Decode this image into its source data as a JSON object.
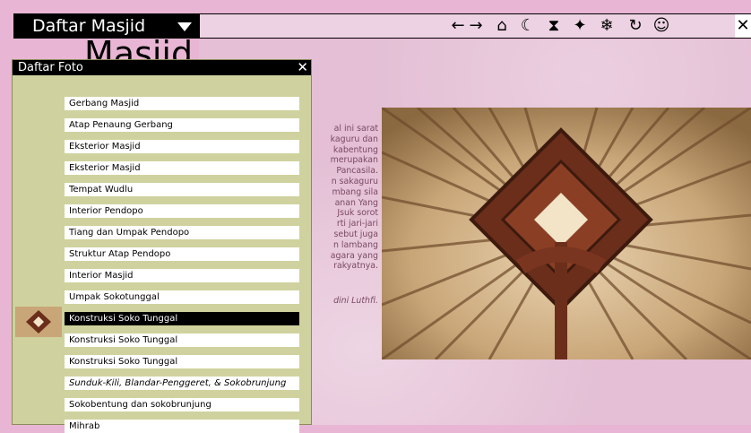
{
  "app": {
    "title": "Daftar Masjid",
    "background_heading": "Masjid"
  },
  "toolbar": {
    "icons": [
      {
        "name": "back-icon",
        "glyph": "←"
      },
      {
        "name": "forward-icon",
        "glyph": "→"
      },
      {
        "name": "home-icon",
        "glyph": "⌂"
      },
      {
        "name": "moon-icon",
        "glyph": "☾"
      },
      {
        "name": "hourglass-icon",
        "glyph": "⧗"
      },
      {
        "name": "compass-icon",
        "glyph": "✦"
      },
      {
        "name": "snowflake-icon",
        "glyph": "❄"
      },
      {
        "name": "refresh-icon",
        "glyph": "↻"
      },
      {
        "name": "smiley-icon",
        "glyph": "☺"
      }
    ],
    "close_glyph": "✕"
  },
  "panel": {
    "title": "Daftar Foto",
    "close_glyph": "✕",
    "items": [
      {
        "label": "Gerbang Masjid",
        "selected": false,
        "italic": false
      },
      {
        "label": "Atap Penaung Gerbang",
        "selected": false,
        "italic": false
      },
      {
        "label": "Eksterior Masjid",
        "selected": false,
        "italic": false
      },
      {
        "label": "Eksterior Masjid",
        "selected": false,
        "italic": false
      },
      {
        "label": "Tempat Wudlu",
        "selected": false,
        "italic": false
      },
      {
        "label": "Interior Pendopo",
        "selected": false,
        "italic": false
      },
      {
        "label": "Tiang dan Umpak Pendopo",
        "selected": false,
        "italic": false
      },
      {
        "label": "Struktur Atap Pendopo",
        "selected": false,
        "italic": false
      },
      {
        "label": "Interior Masjid",
        "selected": false,
        "italic": false
      },
      {
        "label": "Umpak Sokotunggal",
        "selected": false,
        "italic": false
      },
      {
        "label": "Konstruksi Soko Tunggal",
        "selected": true,
        "italic": false
      },
      {
        "label": "Konstruksi Soko Tunggal",
        "selected": false,
        "italic": false
      },
      {
        "label": "Konstruksi Soko Tunggal",
        "selected": false,
        "italic": false
      },
      {
        "label": "Sunduk-Kili, Blandar-Penggeret, & Sokobrunjung",
        "selected": false,
        "italic": true
      },
      {
        "label": "Sokobentung dan sokobrunjung",
        "selected": false,
        "italic": false
      },
      {
        "label": "Mihrab",
        "selected": false,
        "italic": false
      }
    ]
  },
  "article": {
    "lines": [
      "al ini sarat",
      "kaguru dan",
      "kabentung",
      "merupakan",
      "Pancasila.",
      "n sakaguru",
      "mbang sila",
      "anan Yang",
      "Jsuk sorot",
      "rti jari-jari",
      "sebut juga",
      "n lambang",
      "agara yang",
      "rakyatnya."
    ],
    "credit": "dini Luthfi."
  },
  "colors": {
    "page_bg": "#e8b6d4",
    "panel_bg": "#cfd29e",
    "selected_bg": "#000000"
  }
}
